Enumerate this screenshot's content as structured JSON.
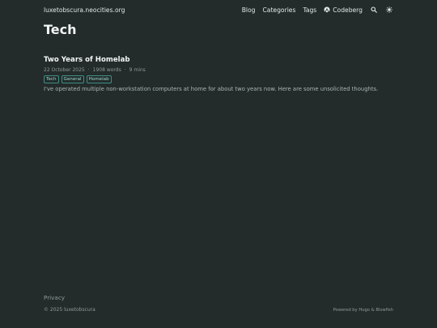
{
  "header": {
    "site_title": "luxetobscura.neocities.org",
    "nav": {
      "blog": "Blog",
      "categories": "Categories",
      "tags": "Tags",
      "codeberg": "Codeberg"
    },
    "icons": {
      "codeberg": "codeberg-icon",
      "search": "search-icon",
      "theme": "sun-icon"
    }
  },
  "main": {
    "page_title": "Tech",
    "articles": [
      {
        "title": "Two Years of Homelab",
        "date": "22 October 2025",
        "separator": "·",
        "words": "1908 words",
        "read_time": "9 mins",
        "tags": [
          "Tech",
          "General",
          "Homelab"
        ],
        "summary": "I've operated multiple non-workstation computers at home for about two years now. Here are some unsolicited thoughts."
      }
    ]
  },
  "footer": {
    "privacy": "Privacy",
    "copyright": "© 2025 luxetobscura",
    "powered_by": "Powered by Hugo & Blowfish"
  },
  "colors": {
    "background": "#232c2b",
    "accent": "#3f8f85",
    "text": "#e2e8e7",
    "muted": "#8e9a99"
  }
}
